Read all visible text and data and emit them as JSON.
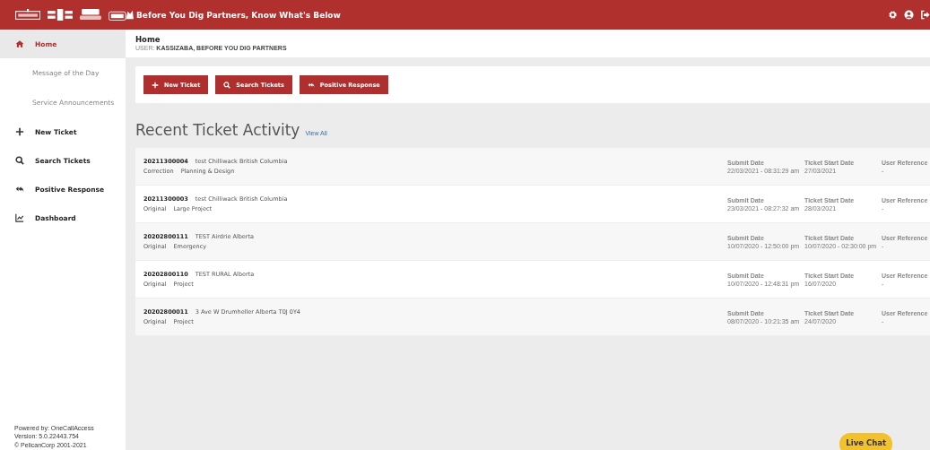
{
  "top_bar": {
    "title": "Before You Dig Partners, Know What's Below"
  },
  "sidebar": {
    "items": [
      {
        "label": "Home",
        "kind": "main",
        "selected": true
      },
      {
        "label": "Message of the Day",
        "kind": "sub",
        "selected": false
      },
      {
        "label": "Service Announcements",
        "kind": "sub",
        "selected": false
      },
      {
        "label": "New Ticket",
        "kind": "main",
        "selected": false
      },
      {
        "label": "Search Tickets",
        "kind": "main",
        "selected": false
      },
      {
        "label": "Positive Response",
        "kind": "main",
        "selected": false
      },
      {
        "label": "Dashboard",
        "kind": "main",
        "selected": false
      }
    ],
    "footer": [
      "Powered by: OneCallAccess",
      "Version: 5.0.22443.754",
      "© PelicanCorp 2001-2021"
    ]
  },
  "header": {
    "title": "Home",
    "user_label": "USER:",
    "user": "KASSIZABA, BEFORE YOU DIG PARTNERS"
  },
  "actions": [
    "New Ticket",
    "Search Tickets",
    "Positive Response"
  ],
  "recent": {
    "title": "Recent Ticket Activity",
    "link": "View All",
    "rows": [
      {
        "number": "20211300004",
        "location": "test Chilliwack British Columbia",
        "type": "Correction",
        "category": "Planning & Design",
        "fields": [
          {
            "label": "Submit Date",
            "value": "22/03/2021 - 08:31:29 am"
          },
          {
            "label": "Ticket Start Date",
            "value": "27/03/2021"
          },
          {
            "label": "User Reference",
            "value": "-"
          }
        ]
      },
      {
        "number": "20211300003",
        "location": "test Chilliwack British Columbia",
        "type": "Original",
        "category": "Large Project",
        "fields": [
          {
            "label": "Submit Date",
            "value": "23/03/2021 - 08:27:32 am"
          },
          {
            "label": "Ticket Start Date",
            "value": "28/03/2021"
          },
          {
            "label": "User Reference",
            "value": "-"
          }
        ]
      },
      {
        "number": "20202800111",
        "location": "TEST Airdrie Alberta",
        "type": "Original",
        "category": "Emergency",
        "fields": [
          {
            "label": "Submit Date",
            "value": "10/07/2020 - 12:50:00 pm"
          },
          {
            "label": "Ticket Start Date",
            "value": "10/07/2020 - 02:30:00 pm"
          },
          {
            "label": "User Reference",
            "value": "-"
          }
        ]
      },
      {
        "number": "20202800110",
        "location": "TEST RURAL Alberta",
        "type": "Original",
        "category": "Project",
        "fields": [
          {
            "label": "Submit Date",
            "value": "10/07/2020 - 12:48:31 pm"
          },
          {
            "label": "Ticket Start Date",
            "value": "16/07/2020"
          },
          {
            "label": "User Reference",
            "value": "-"
          }
        ]
      },
      {
        "number": "20202800011",
        "location": "3 Ave W Drumheller Alberta T0J 0Y4",
        "type": "Original",
        "category": "Project",
        "fields": [
          {
            "label": "Submit Date",
            "value": "08/07/2020 - 10:21:35 am"
          },
          {
            "label": "Ticket Start Date",
            "value": "24/07/2020"
          },
          {
            "label": "User Reference",
            "value": "-"
          }
        ]
      }
    ]
  },
  "live_chat": "Live Chat"
}
